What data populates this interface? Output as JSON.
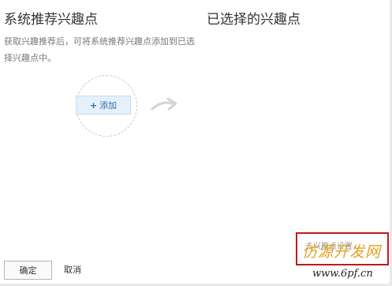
{
  "left_panel": {
    "title": "系统推荐兴趣点",
    "description": "获取兴趣推荐后，可将系统推荐兴趣点添加到已选择兴趣点中。",
    "add_button_icon": "plus-icon",
    "add_label": "添加"
  },
  "right_panel": {
    "title": "已选择的兴趣点"
  },
  "footer": {
    "confirm_label": "确定",
    "cancel_label": "取消"
  },
  "watermark": {
    "text": "仿源开发网",
    "url": "www.6pf.cn",
    "behind_text": "去兴趣点设置"
  },
  "colors": {
    "tag_background": "#e4f1fb",
    "tag_text": "#2f6fa8",
    "watermark_border": "#c0191d",
    "watermark_text": "#e0a020"
  }
}
